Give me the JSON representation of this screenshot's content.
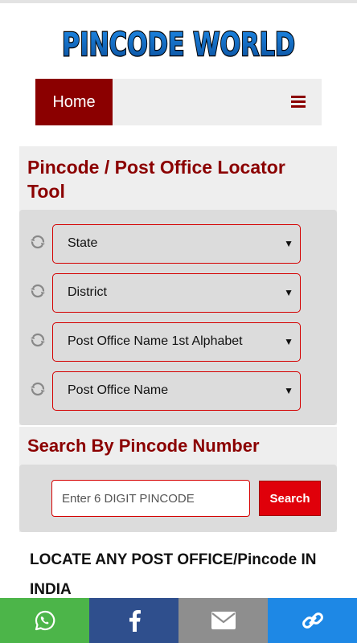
{
  "site": {
    "logo_text": "PINCODE WORLD"
  },
  "nav": {
    "home_label": "Home"
  },
  "tool": {
    "title": "Pincode / Post Office Locator Tool",
    "selects": [
      {
        "label": "State"
      },
      {
        "label": "District"
      },
      {
        "label": "Post Office Name 1st Alphabet"
      },
      {
        "label": "Post Office Name"
      }
    ]
  },
  "search": {
    "title": "Search By Pincode Number",
    "placeholder": "Enter 6 DIGIT PINCODE",
    "button_label": "Search"
  },
  "locate": {
    "text": "LOCATE ANY POST OFFICE/Pincode IN INDIA"
  },
  "share": [
    {
      "icon": "whatsapp-icon",
      "color": "#4cb549"
    },
    {
      "icon": "facebook-icon",
      "color": "#2f4f8d"
    },
    {
      "icon": "email-icon",
      "color": "#8e8e8e"
    },
    {
      "icon": "link-icon",
      "color": "#1e88e5"
    }
  ],
  "colors": {
    "brand": "#8b0000",
    "accent_red": "#e0000a",
    "panel": "#eeeeee"
  }
}
